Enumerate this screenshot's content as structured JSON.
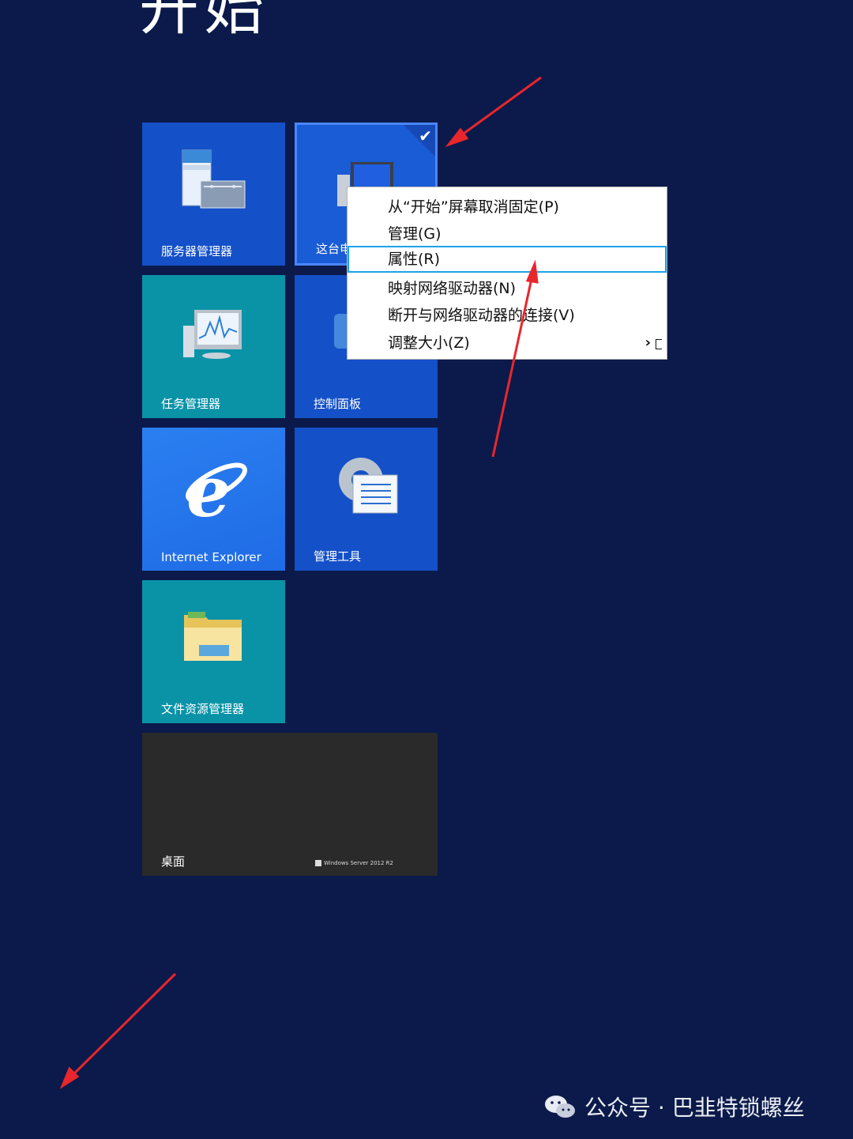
{
  "start_screen": {
    "title": "开始",
    "tiles": {
      "server_manager": "服务器管理器",
      "this_pc": "这台电",
      "task_manager": "任务管理器",
      "control_panel": "控制面板",
      "internet_explorer": "Internet Explorer",
      "admin_tools": "管理工具",
      "file_explorer": "文件资源管理器",
      "desktop": "桌面",
      "desktop_badge": "Windows Server 2012 R2"
    }
  },
  "context_menu": {
    "items": [
      "从“开始”屏幕取消固定(P)",
      "管理(G)",
      "属性(R)",
      "映射网络驱动器(N)",
      "断开与网络驱动器的连接(V)",
      "调整大小(Z)"
    ],
    "selected_index": 2
  },
  "watermark": {
    "text": "公众号 · 巴韭特锁螺丝"
  },
  "colors": {
    "background": "#0b1a4a",
    "tile_blue": "#1450c8",
    "tile_teal": "#0a93a7",
    "highlight_border": "#1aa3e8",
    "annotation_arrow": "#e8262b"
  }
}
